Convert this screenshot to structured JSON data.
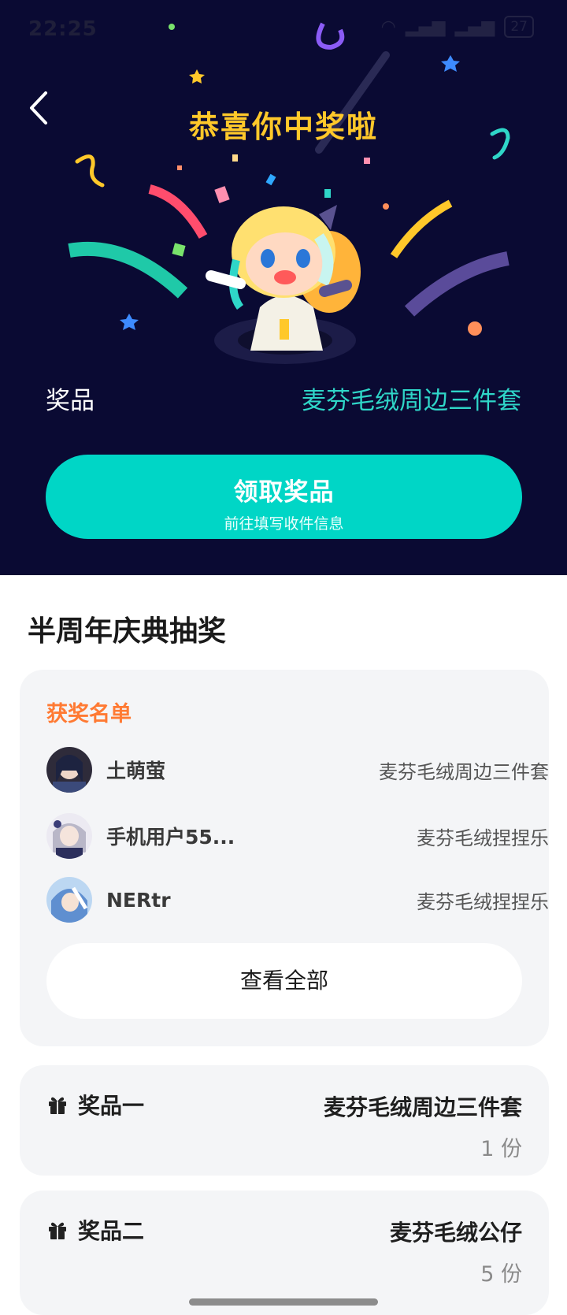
{
  "status_bar": {
    "time": "22:25",
    "battery": "27"
  },
  "hero": {
    "congrats": "恭喜你中奖啦",
    "prize_label": "奖品",
    "prize_value": "麦芬毛绒周边三件套",
    "claim_button": {
      "label": "领取奖品",
      "sublabel": "前往填写收件信息"
    }
  },
  "section": {
    "title": "半周年庆典抽奖"
  },
  "winners": {
    "heading": "获奖名单",
    "rows": [
      {
        "name": "土萌萤",
        "prize": "麦芬毛绒周边三件套"
      },
      {
        "name": "手机用户55...",
        "prize": "麦芬毛绒捏捏乐"
      },
      {
        "name": "NERtr",
        "prize": "麦芬毛绒捏捏乐"
      }
    ],
    "view_all": "查看全部"
  },
  "prizes": [
    {
      "title": "奖品一",
      "name": "麦芬毛绒周边三件套",
      "count": "1 份"
    },
    {
      "title": "奖品二",
      "name": "麦芬毛绒公仔",
      "count": "5 份"
    }
  ],
  "colors": {
    "hero_bg": "#0a0a33",
    "accent_teal": "#00d6c6",
    "congrats_yellow": "#ffc82a",
    "winners_orange": "#ff7a33"
  }
}
